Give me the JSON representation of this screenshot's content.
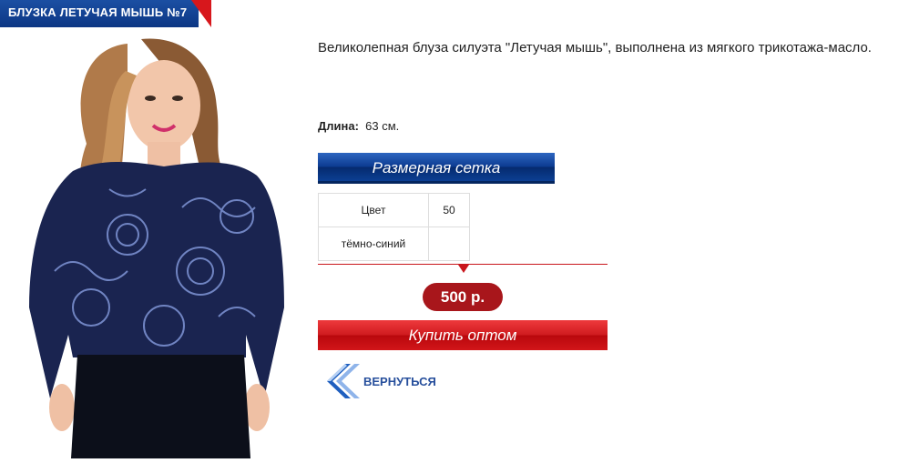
{
  "product": {
    "title": "БЛУЗКА ЛЕТУЧАЯ МЫШЬ №7",
    "description": "Великолепная блуза силуэта \"Летучая мышь\", выполнена из мягкого трикотажа-масло.",
    "length_label": "Длина:",
    "length_value": "63 см.",
    "price": "500 р."
  },
  "size_grid": {
    "button_label": "Размерная сетка",
    "header": [
      "Цвет",
      "50"
    ],
    "rows": [
      [
        "тёмно-синий",
        ""
      ]
    ]
  },
  "actions": {
    "buy_label": "Купить оптом",
    "back_label": "ВЕРНУТЬСЯ",
    "back_icon": "double-chevron-left-icon"
  },
  "colors": {
    "brand_blue": "#0c3784",
    "accent_red": "#c9161c",
    "price_bg": "#a8161b"
  }
}
